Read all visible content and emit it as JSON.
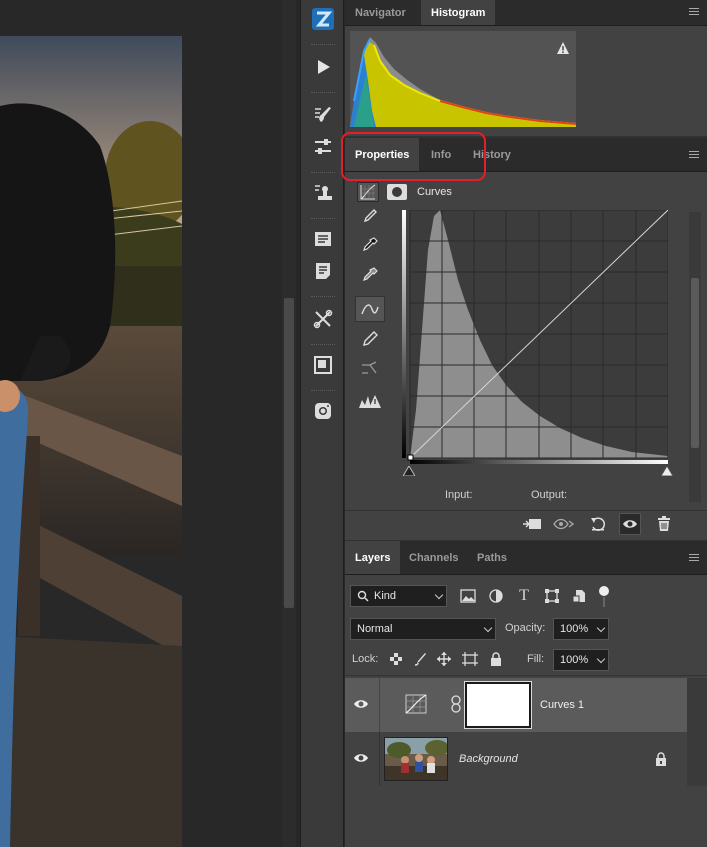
{
  "toolstrip": {
    "items": [
      "z-logo-icon",
      "play-icon",
      "brush-settings-icon",
      "adjust-sliders-icon",
      "stamp-icon",
      "paragraph-icon",
      "document-icon",
      "tools-icon",
      "artboard-icon",
      "instagram-icon"
    ]
  },
  "top_panel": {
    "tabs": [
      {
        "label": "Navigator",
        "active": false
      },
      {
        "label": "Histogram",
        "active": true
      }
    ],
    "warning_symbol": "!"
  },
  "properties_panel": {
    "tabs": [
      {
        "label": "Properties",
        "active": true
      },
      {
        "label": "Info",
        "active": false
      },
      {
        "label": "History",
        "active": false
      }
    ],
    "adjustment_title": "Curves",
    "input_label": "Input:",
    "output_label": "Output:"
  },
  "layers_panel": {
    "tabs": [
      {
        "label": "Layers",
        "active": true
      },
      {
        "label": "Channels",
        "active": false
      },
      {
        "label": "Paths",
        "active": false
      }
    ],
    "filter_kind": "Kind",
    "blend_mode": "Normal",
    "opacity_label": "Opacity:",
    "opacity_value": "100%",
    "lock_label": "Lock:",
    "fill_label": "Fill:",
    "fill_value": "100%",
    "layers": [
      {
        "name": "Curves 1",
        "selected": true,
        "italic": false
      },
      {
        "name": "Background",
        "selected": false,
        "italic": true
      }
    ]
  },
  "colors": {
    "highlight_ring": "#e0202a",
    "panel_bg": "#424242",
    "selected_layer": "#5b5b5b",
    "zlogo": "#1e8fe0"
  }
}
